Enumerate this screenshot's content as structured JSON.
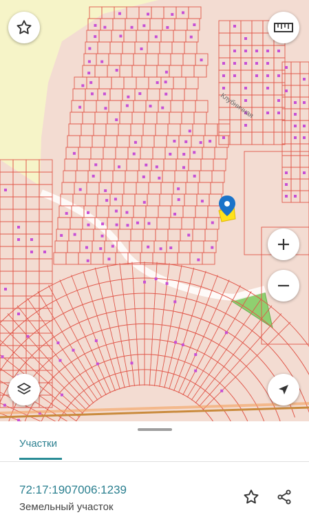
{
  "map": {
    "street_label": "Клубничная",
    "controls": {
      "favorite_icon": "star-outline-icon",
      "ruler_icon": "ruler-icon",
      "zoom_in_icon": "plus-icon",
      "zoom_out_icon": "minus-icon",
      "layers_icon": "layers-icon",
      "location_icon": "navigation-arrow-icon"
    },
    "colors": {
      "parcel_line": "#e0574a",
      "background": "#f3dcd2",
      "forest": "#f6f4c8",
      "building": "#c64fd6",
      "selected_parcel": "#ffe21a",
      "green_area": "#8fd070",
      "marker": "#1a73c9",
      "road": "#c98a3c"
    }
  },
  "sheet": {
    "tab_label": "Участки",
    "cadastral_number": "72:17:1907006:1239",
    "parcel_type": "Земельный участок",
    "accent_color": "#2a8c96"
  }
}
